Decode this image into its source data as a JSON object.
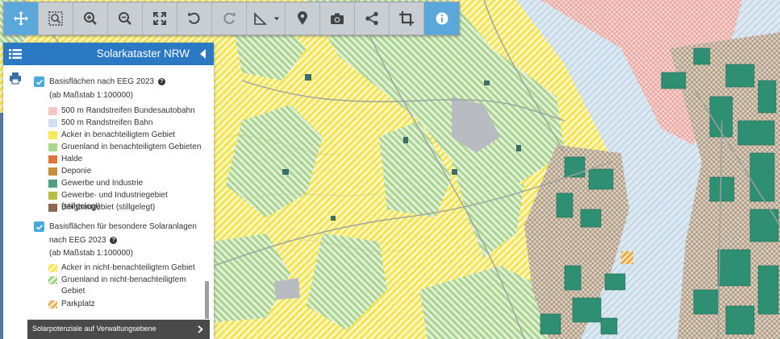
{
  "toolbar": {
    "buttons": [
      {
        "name": "pan",
        "icon": "move-icon",
        "active": true
      },
      {
        "name": "zoom-box",
        "icon": "zoom-box-icon"
      },
      {
        "name": "zoom-in",
        "icon": "zoom-in-icon"
      },
      {
        "name": "zoom-out",
        "icon": "zoom-out-icon"
      },
      {
        "name": "full-extent",
        "icon": "expand-icon"
      },
      {
        "name": "undo",
        "icon": "undo-icon"
      },
      {
        "name": "redo",
        "icon": "redo-icon",
        "disabled": true
      },
      {
        "name": "measure",
        "icon": "measure-icon"
      },
      {
        "name": "marker",
        "icon": "marker-icon"
      },
      {
        "name": "screenshot",
        "icon": "camera-icon"
      },
      {
        "name": "share",
        "icon": "share-icon"
      },
      {
        "name": "crop",
        "icon": "crop-icon"
      },
      {
        "name": "info",
        "icon": "info-icon",
        "active": true
      }
    ],
    "accent": "#5aa7dc"
  },
  "panel": {
    "title": "Solarkataster NRW",
    "header_color": "#2b79c2",
    "group1": {
      "title": "Basisflächen nach EEG 2023",
      "scale": "(ab Maßstab 1:100000)",
      "items": [
        {
          "label": "500 m Randstreifen Bundesautobahn",
          "color": "#f4c7c3"
        },
        {
          "label": "500 m Randstreifen Bahn",
          "color": "#cfe0f4"
        },
        {
          "label": "Acker in benachteiligtem Gebiet",
          "color": "#f6ea55"
        },
        {
          "label": "Gruenland in benachteiligtem Gebieten",
          "color": "#a8d98a"
        },
        {
          "label": "Halde",
          "color": "#e2743a"
        },
        {
          "label": "Deponie",
          "color": "#c88f3b"
        },
        {
          "label": "Gewerbe und Industrie",
          "color": "#4f9e84"
        },
        {
          "label": "Gewerbe- und Industriegebiet (stillgelegt)",
          "color": "#b6be44"
        },
        {
          "label": "Bergbaugebiet (stillgelegt)",
          "color": "#8c6b52"
        }
      ]
    },
    "group2": {
      "title_line1": "Basisflächen für besondere Solaranlagen",
      "title_line2": "nach EEG 2023",
      "scale": "(ab Maßstab 1:100000)",
      "items": [
        {
          "label": "Acker in nicht-benachteiligtem Gebiet",
          "color": "#f2e040"
        },
        {
          "label": "Gruenland in nicht-benachteiligtem Gebiet",
          "color": "#8cc96a"
        },
        {
          "label": "Parkplatz",
          "color": "#e0a03a"
        }
      ]
    },
    "footer_label": "Solarpotenziale auf Verwaltungsebene"
  }
}
